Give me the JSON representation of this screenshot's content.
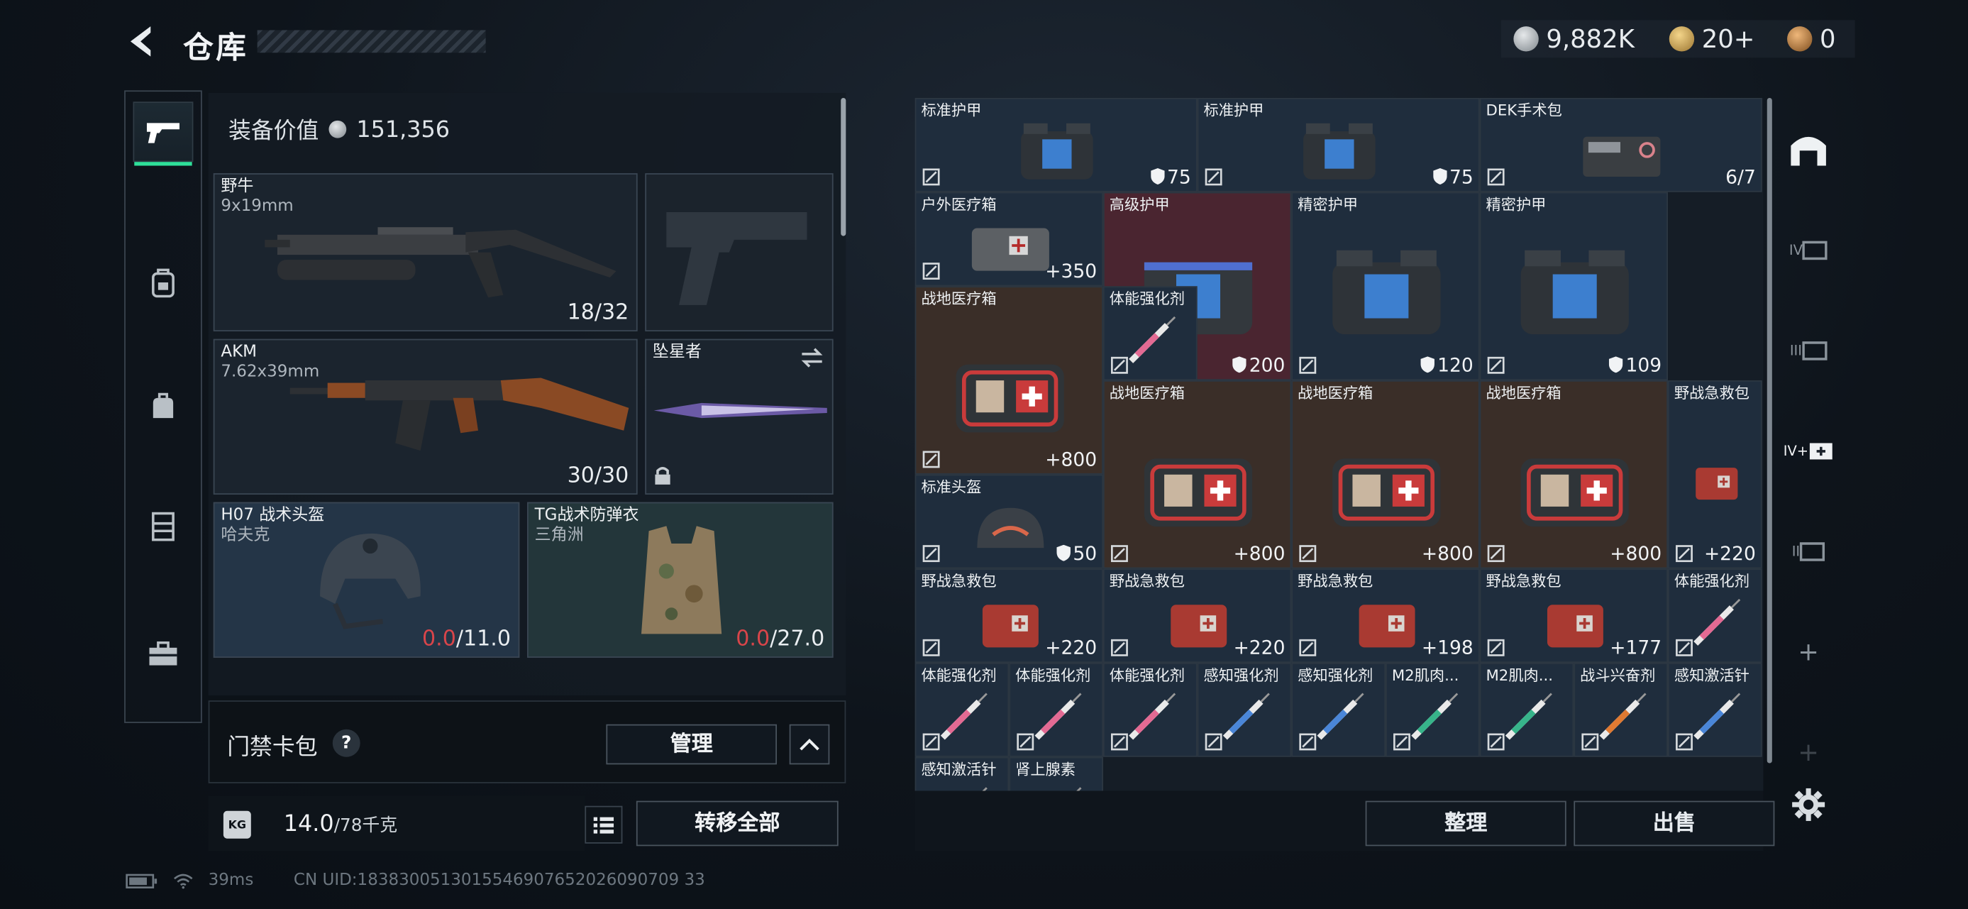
{
  "header": {
    "title": "仓库",
    "currencies": [
      {
        "value": "9,882K",
        "icon": "silver-coin-icon",
        "color": "#b7bcc1"
      },
      {
        "value": "20+",
        "icon": "gold-triangle-coin-icon",
        "color": "#d8b25b"
      },
      {
        "value": "0",
        "icon": "bronze-coin-icon",
        "color": "#c98d4a"
      }
    ]
  },
  "loadout": {
    "equipment_value_label": "装备价值",
    "equipment_value": "151,356",
    "primary": {
      "name": "野牛",
      "caliber": "9x19mm",
      "ammo": "18/32"
    },
    "sidearm": {
      "name": "",
      "ammo": ""
    },
    "secondary": {
      "name": "AKM",
      "caliber": "7.62x39mm",
      "ammo": "30/30"
    },
    "melee": {
      "name": "坠星者"
    },
    "helmet": {
      "name": "H07 战术头盔",
      "sub": "哈夫克",
      "dur_cur": "0.0",
      "dur_max": "/11.0"
    },
    "armor": {
      "name": "TG战术防弹衣",
      "sub": "三角洲",
      "dur_cur": "0.0",
      "dur_max": "/27.0"
    }
  },
  "access_card": {
    "label": "门禁卡包",
    "help": "?",
    "manage": "管理"
  },
  "weight": {
    "current": "14.0",
    "max": "/78千克",
    "kg": "KG"
  },
  "transfer_all": "转移全部",
  "status": {
    "ping": "39ms",
    "uid": "CN UID:1838300513015546907652026090709 33"
  },
  "grid": {
    "items": [
      {
        "name": "标准护甲",
        "value": "75",
        "kind": "armor"
      },
      {
        "name": "标准护甲",
        "value": "75",
        "kind": "armor"
      },
      {
        "name": "DEK手术包",
        "value": "6/7",
        "kind": "surgery"
      },
      {
        "name": "户外医疗箱",
        "value": "+350",
        "kind": "outdoor-kit"
      },
      {
        "name": "高级护甲",
        "value": "200",
        "kind": "armor-adv"
      },
      {
        "name": "精密护甲",
        "value": "120",
        "kind": "armor"
      },
      {
        "name": "精密护甲",
        "value": "109",
        "kind": "armor"
      },
      {
        "name": "战地医疗箱",
        "value": "+800",
        "kind": "medkit"
      },
      {
        "name": "体能强化剂",
        "value": "",
        "kind": "syringe-pink"
      },
      {
        "name": "战地医疗箱",
        "value": "+800",
        "kind": "medkit"
      },
      {
        "name": "战地医疗箱",
        "value": "+800",
        "kind": "medkit"
      },
      {
        "name": "战地医疗箱",
        "value": "+800",
        "kind": "medkit"
      },
      {
        "name": "野战急救包",
        "value": "+220",
        "kind": "firstaid"
      },
      {
        "name": "标准头盔",
        "value": "50",
        "kind": "helmet"
      },
      {
        "name": "野战急救包",
        "value": "+220",
        "kind": "firstaid"
      },
      {
        "name": "野战急救包",
        "value": "+220",
        "kind": "firstaid"
      },
      {
        "name": "野战急救包",
        "value": "+198",
        "kind": "firstaid"
      },
      {
        "name": "野战急救包",
        "value": "+177",
        "kind": "firstaid"
      },
      {
        "name": "体能强化剂",
        "value": "",
        "kind": "syringe-pink"
      },
      {
        "name": "体能强化剂",
        "value": "",
        "kind": "syringe-pink"
      },
      {
        "name": "体能强化剂",
        "value": "",
        "kind": "syringe-pink"
      },
      {
        "name": "体能强化剂",
        "value": "",
        "kind": "syringe-pink"
      },
      {
        "name": "感知强化剂",
        "value": "",
        "kind": "syringe-blue"
      },
      {
        "name": "感知强化剂",
        "value": "",
        "kind": "syringe-blue"
      },
      {
        "name": "M2肌肉...",
        "value": "",
        "kind": "syringe-green"
      },
      {
        "name": "M2肌肉...",
        "value": "",
        "kind": "syringe-green"
      },
      {
        "name": "战斗兴奋剂",
        "value": "",
        "kind": "syringe-orange"
      },
      {
        "name": "感知激活针",
        "value": "",
        "kind": "syringe-blue"
      },
      {
        "name": "感知激活针",
        "value": "",
        "kind": "syringe-blue"
      },
      {
        "name": "肾上腺素",
        "value": "",
        "kind": "syringe-blue"
      }
    ]
  },
  "actions": {
    "sort": "整理",
    "sell": "出售"
  },
  "right_tabs": [
    "IV",
    "III",
    "IV+",
    "II",
    "+",
    "+"
  ]
}
